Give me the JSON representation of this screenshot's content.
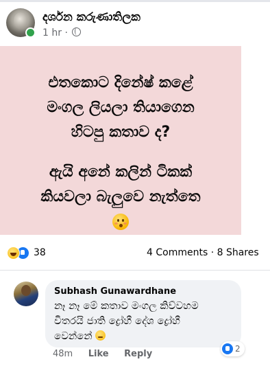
{
  "post": {
    "author": "දර්ශන කරුණාතිලක",
    "time": "1 hr",
    "separator": "·",
    "image_text": {
      "lines_top": [
        "එතකොට දිනේෂ් කළේ",
        "මංගල ලියලා තියාගෙන",
        "හිටපු කතාව ද?"
      ],
      "lines_bottom": [
        "ඇයි අනේ කලින් ටිකක්",
        "කියවලා බැලුවෙ නැත්තෙ"
      ]
    },
    "background_color": "#f3d8d9"
  },
  "reactions": {
    "icons": [
      "haha-icon",
      "like-icon"
    ],
    "count": "38"
  },
  "stats": {
    "comments": "4 Comments",
    "separator": "·",
    "shares": "8 Shares"
  },
  "comment": {
    "author": "Subhash Gunawardhane",
    "lines": [
      "නෑ නෑ මේ කතාව මංගල කිව්වහම",
      "විතරයි ජාති ද්‍රෝහී දේශ ද්‍රෝහී",
      "වෙන්නේ"
    ],
    "time": "48m",
    "like_label": "Like",
    "reply_label": "Reply",
    "reaction_count": "2"
  },
  "colors": {
    "accent": "#1877f2",
    "online": "#31a24c",
    "bubble": "#f0f2f5"
  }
}
